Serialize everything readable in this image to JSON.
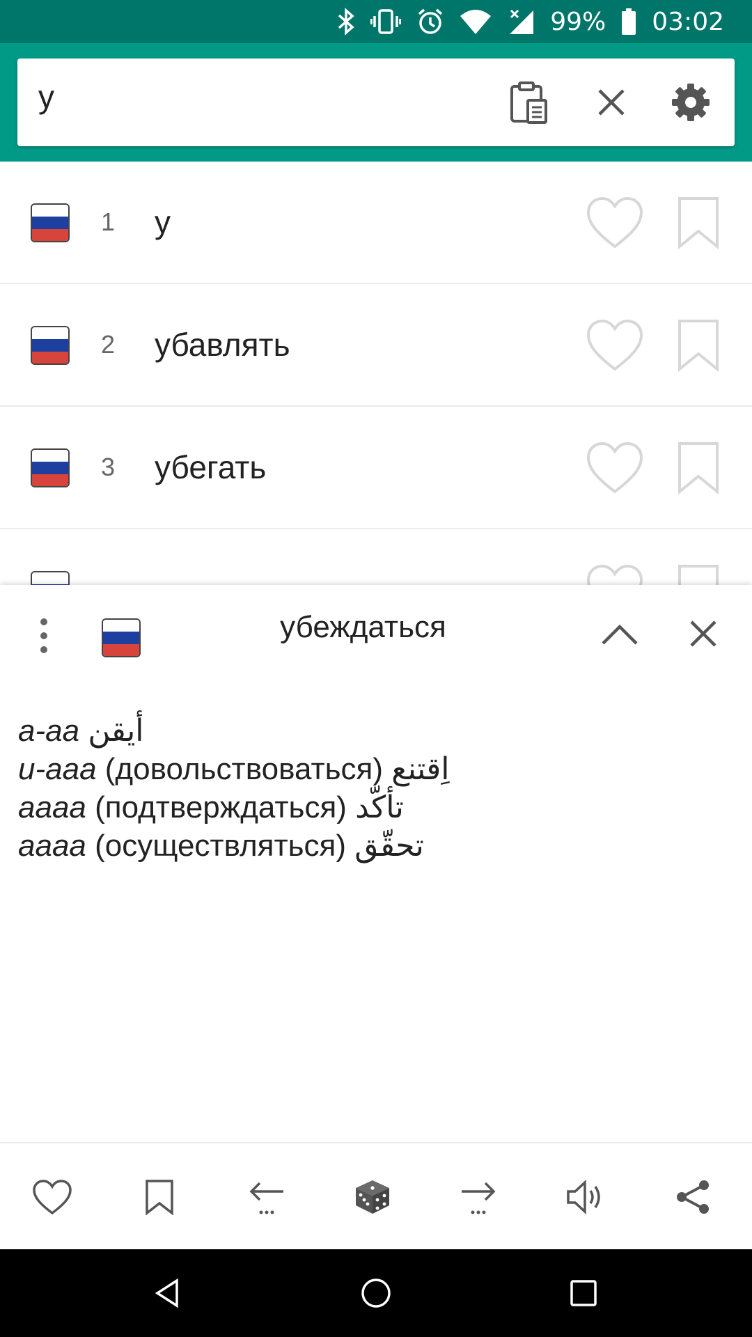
{
  "status_bar": {
    "battery": "99%",
    "time": "03:02",
    "icons": [
      "bluetooth-icon",
      "vibrate-icon",
      "alarm-icon",
      "wifi-icon",
      "signal-icon",
      "battery-icon"
    ]
  },
  "search": {
    "query": "у",
    "icons": [
      "clipboard-icon",
      "clear-icon",
      "settings-icon"
    ]
  },
  "flag_colors": [
    "#ffffff",
    "#1c3fa0",
    "#d6443b"
  ],
  "accent_color": "#009a87",
  "list": {
    "items": [
      {
        "number": "1",
        "word": "у"
      },
      {
        "number": "2",
        "word": "убавлять"
      },
      {
        "number": "3",
        "word": "убегать"
      }
    ]
  },
  "panel": {
    "title": "убеждаться",
    "definitions": [
      {
        "form": "а-аа",
        "gloss": "",
        "translation": "أيقن"
      },
      {
        "form": "и-ааа",
        "gloss": "(довольствоваться)",
        "translation": "اِقتنع"
      },
      {
        "form": "аааа",
        "gloss": "(подтверждаться)",
        "translation": "تأكّد"
      },
      {
        "form": "аааа",
        "gloss": "(осуществляться)",
        "translation": "تحقّق"
      }
    ]
  },
  "toolbar": {
    "icons": [
      "heart-icon",
      "bookmark-icon",
      "back-arrow-icon",
      "dice-icon",
      "forward-arrow-icon",
      "speaker-icon",
      "share-icon"
    ]
  },
  "navbar": {
    "icons": [
      "nav-back-icon",
      "nav-home-icon",
      "nav-recents-icon"
    ]
  }
}
